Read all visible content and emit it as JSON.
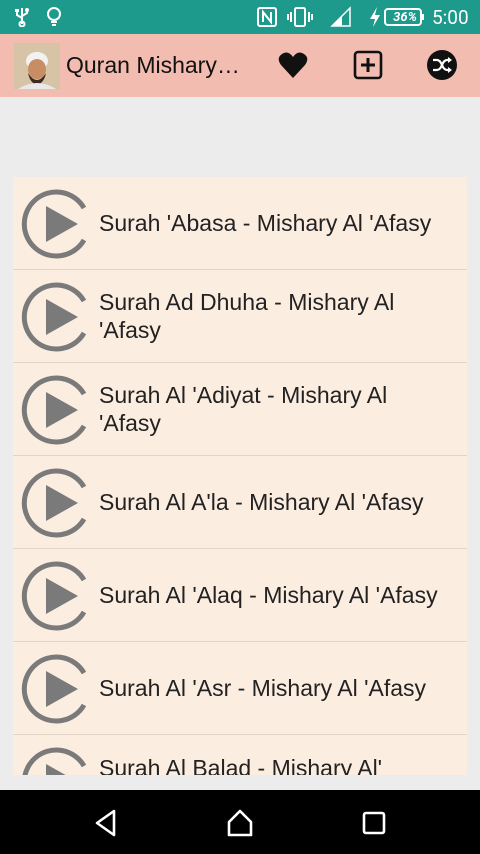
{
  "status": {
    "battery_percent": "36%",
    "time": "5:00"
  },
  "app": {
    "title": "Quran Mishary…"
  },
  "actions": [
    {
      "name": "favorite-button",
      "icon": "heart-icon"
    },
    {
      "name": "add-button",
      "icon": "plus-box-icon"
    },
    {
      "name": "shuffle-button",
      "icon": "shuffle-icon"
    }
  ],
  "tracks": [
    {
      "label": "Surah 'Abasa - Mishary Al 'Afasy"
    },
    {
      "label": "Surah Ad Dhuha - Mishary Al 'Afasy"
    },
    {
      "label": "Surah Al 'Adiyat - Mishary Al 'Afasy"
    },
    {
      "label": "Surah Al A'la - Mishary Al 'Afasy"
    },
    {
      "label": "Surah Al 'Alaq - Mishary Al 'Afasy"
    },
    {
      "label": "Surah Al 'Asr - Mishary Al 'Afasy"
    },
    {
      "label": "Surah Al Balad - Mishary Al'"
    }
  ],
  "colors": {
    "statusbar": "#1e9a8c",
    "appbar": "#f2bcb0",
    "list_bg": "#fcede1",
    "play_icon": "#7a7a7a"
  }
}
